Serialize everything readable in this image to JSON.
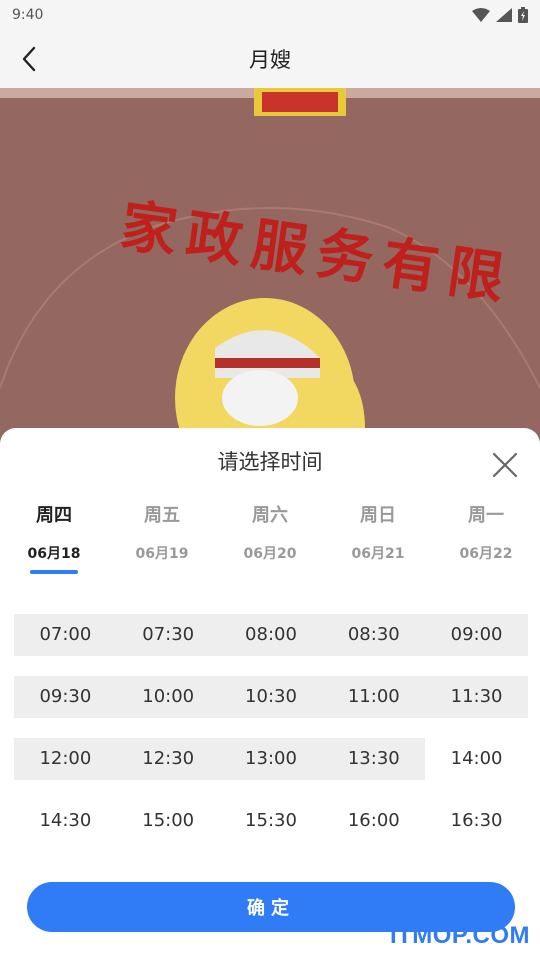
{
  "status_bar": {
    "time": "9:40"
  },
  "nav": {
    "title": "月嫂"
  },
  "hero": {
    "sign_text": "家政服务有限"
  },
  "sheet": {
    "title": "请选择时间",
    "days": [
      {
        "weekday": "周四",
        "date": "06月18",
        "active": true
      },
      {
        "weekday": "周五",
        "date": "06月19",
        "active": false
      },
      {
        "weekday": "周六",
        "date": "06月20",
        "active": false
      },
      {
        "weekday": "周日",
        "date": "06月21",
        "active": false
      },
      {
        "weekday": "周一",
        "date": "06月22",
        "active": false
      }
    ],
    "time_rows": [
      [
        {
          "t": "07:00",
          "filled": true
        },
        {
          "t": "07:30",
          "filled": true
        },
        {
          "t": "08:00",
          "filled": true
        },
        {
          "t": "08:30",
          "filled": true
        },
        {
          "t": "09:00",
          "filled": true
        }
      ],
      [
        {
          "t": "09:30",
          "filled": true
        },
        {
          "t": "10:00",
          "filled": true
        },
        {
          "t": "10:30",
          "filled": true
        },
        {
          "t": "11:00",
          "filled": true
        },
        {
          "t": "11:30",
          "filled": true
        }
      ],
      [
        {
          "t": "12:00",
          "filled": true
        },
        {
          "t": "12:30",
          "filled": true
        },
        {
          "t": "13:00",
          "filled": true
        },
        {
          "t": "13:30",
          "filled": true
        },
        {
          "t": "14:00",
          "filled": false
        }
      ],
      [
        {
          "t": "14:30",
          "filled": false
        },
        {
          "t": "15:00",
          "filled": false
        },
        {
          "t": "15:30",
          "filled": false
        },
        {
          "t": "16:00",
          "filled": false
        },
        {
          "t": "16:30",
          "filled": false
        }
      ]
    ],
    "confirm_label": "确定"
  },
  "watermark": "ITMOP.COM",
  "colors": {
    "accent": "#2f7cf6",
    "slot_bg": "#eeeeee"
  },
  "icons": {
    "back": "chevron-left-icon",
    "close": "close-icon",
    "wifi": "wifi-icon",
    "signal": "signal-icon",
    "battery": "battery-icon"
  }
}
